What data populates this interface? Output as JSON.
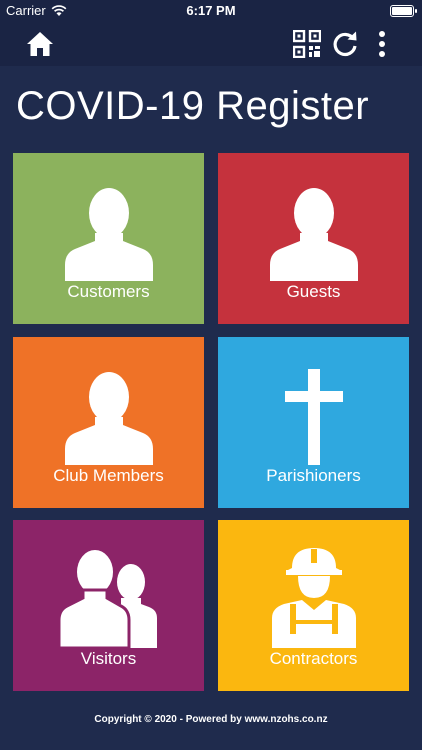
{
  "status": {
    "carrier": "Carrier",
    "time": "6:17 PM"
  },
  "nav": {
    "home_icon": "home-icon",
    "qr_icon": "qr-code-icon",
    "refresh_icon": "refresh-icon",
    "more_icon": "more-vertical-icon"
  },
  "title": "COVID-19 Register",
  "tiles": [
    {
      "label": "Customers",
      "icon": "person-icon",
      "color": "#8cb25d"
    },
    {
      "label": "Guests",
      "icon": "person-icon",
      "color": "#c5323d"
    },
    {
      "label": "Club Members",
      "icon": "person-icon",
      "color": "#ef7227"
    },
    {
      "label": "Parishioners",
      "icon": "cross-icon",
      "color": "#2fa8df"
    },
    {
      "label": "Visitors",
      "icon": "people-icon",
      "color": "#8c2468"
    },
    {
      "label": "Contractors",
      "icon": "worker-icon",
      "color": "#fbb70f"
    }
  ],
  "footer": {
    "copyright": "Copyright © 2020 - Powered by www.nzohs.co.nz"
  }
}
